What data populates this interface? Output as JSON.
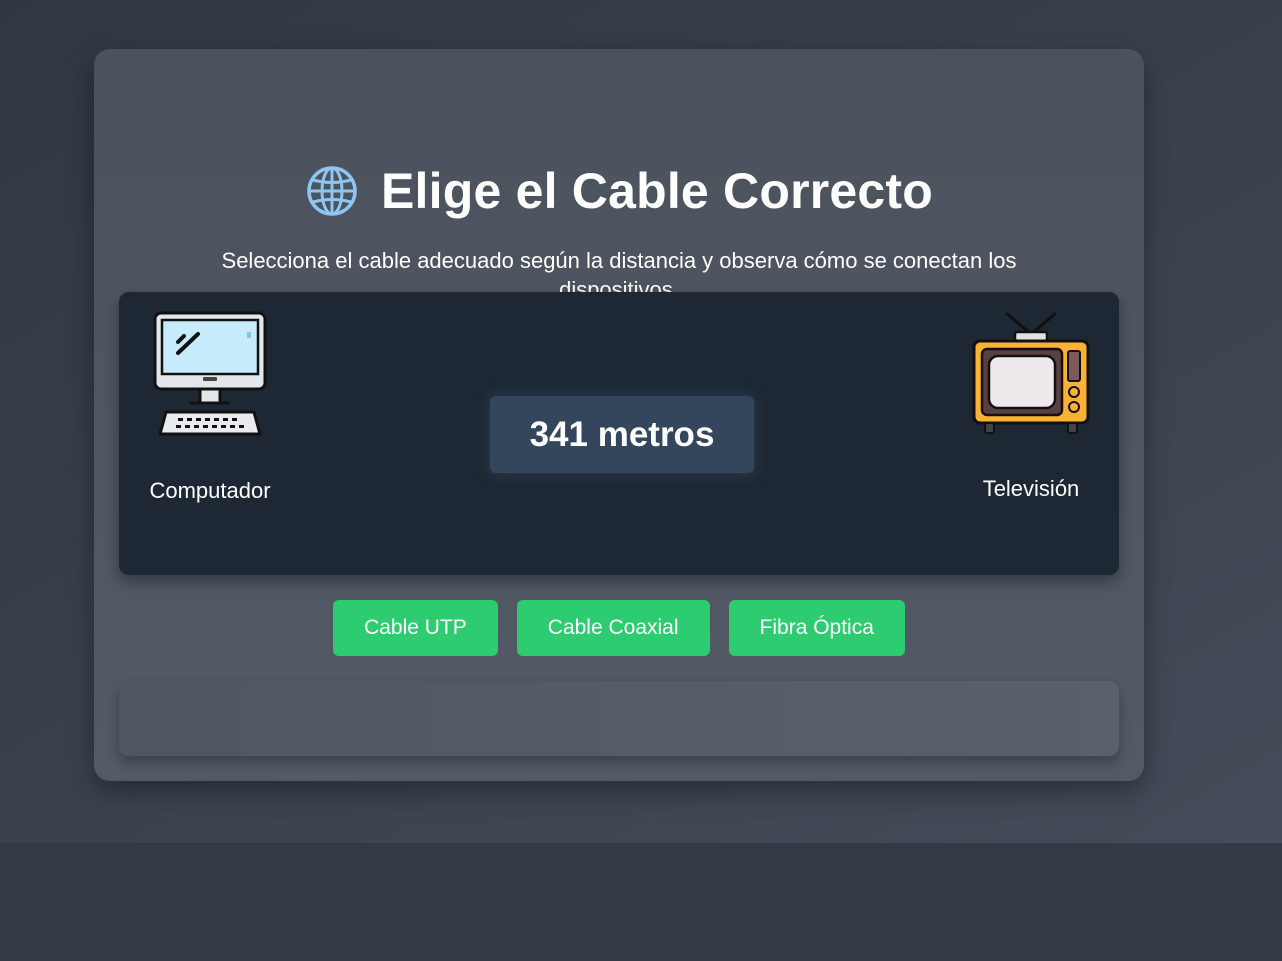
{
  "header": {
    "title": "Elige el Cable Correcto",
    "title_icon": "globe-icon",
    "subtitle": "Selecciona el cable adecuado según la distancia y observa cómo se conectan los dispositivos."
  },
  "stage": {
    "left_device": {
      "label": "Computador",
      "icon": "computer-icon"
    },
    "right_device": {
      "label": "Televisión",
      "icon": "tv-icon"
    },
    "distance_label": "341 metros"
  },
  "buttons": [
    {
      "label": "Cable UTP"
    },
    {
      "label": "Cable Coaxial"
    },
    {
      "label": "Fibra Óptica"
    }
  ],
  "result": {
    "text": ""
  },
  "colors": {
    "accent": "#2ecc71",
    "stage_background": "#1e2835",
    "card_background": "#4f5661"
  }
}
